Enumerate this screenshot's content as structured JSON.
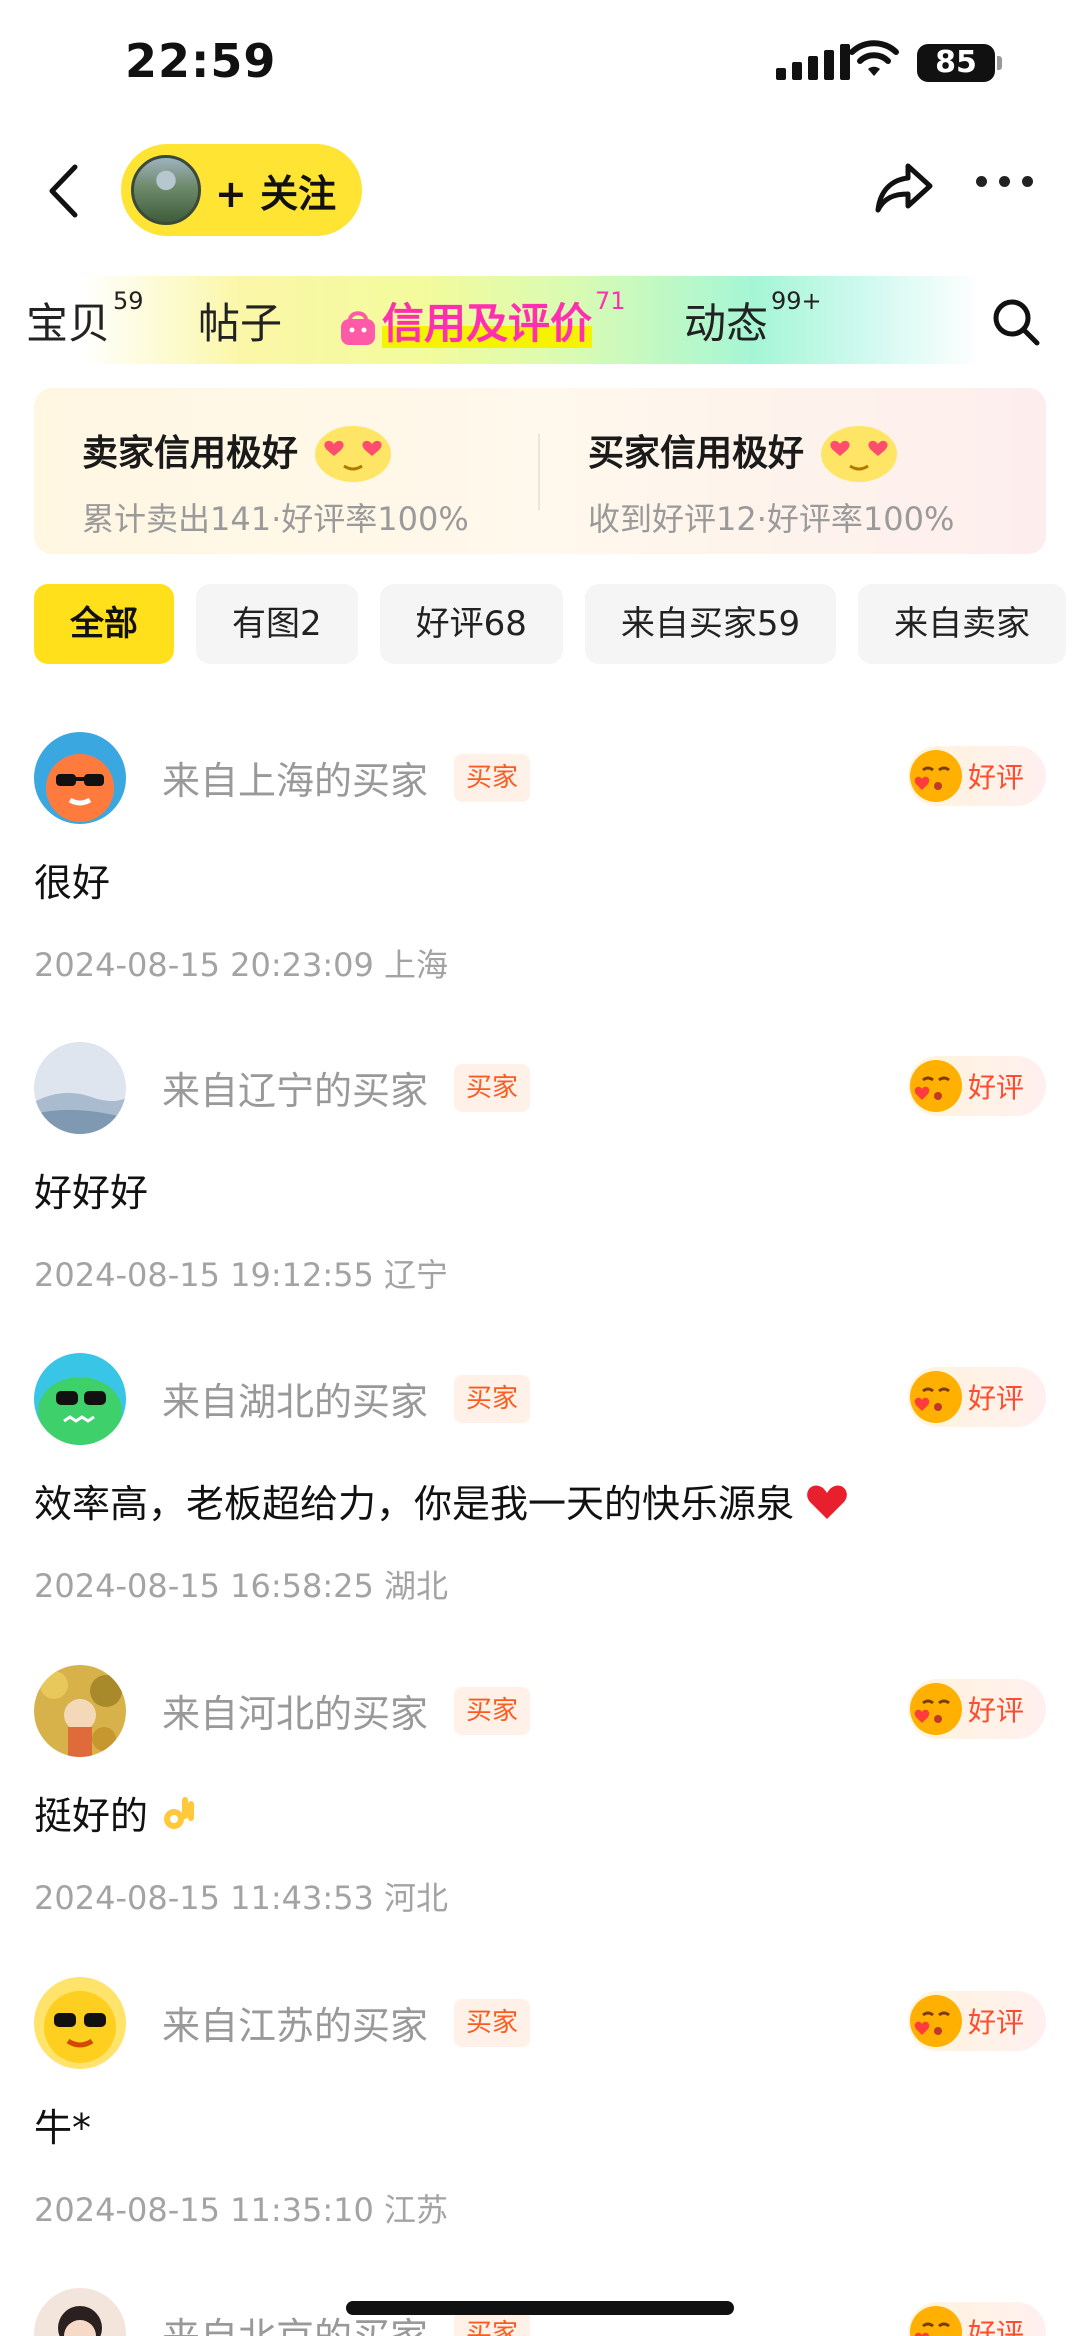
{
  "status_bar": {
    "time": "22:59",
    "battery": "85"
  },
  "header": {
    "follow_label": "+ 关注"
  },
  "tabs": [
    {
      "label": "宝贝",
      "count": "59"
    },
    {
      "label": "帖子",
      "count": ""
    },
    {
      "label": "信用及评价",
      "count": "71",
      "active": true
    },
    {
      "label": "动态",
      "count": "99+"
    }
  ],
  "credit": {
    "seller": {
      "title": "卖家信用极好",
      "sub": "累计卖出141·好评率100%"
    },
    "buyer": {
      "title": "买家信用极好",
      "sub": "收到好评12·好评率100%"
    }
  },
  "filters": [
    "全部",
    "有图2",
    "好评68",
    "来自买家59",
    "来自卖家"
  ],
  "reviews": [
    {
      "name": "来自上海的买家",
      "badge": "买家",
      "rating": "好评",
      "content": "很好",
      "time": "2024-08-15 20:23:09 上海"
    },
    {
      "name": "来自辽宁的买家",
      "badge": "买家",
      "rating": "好评",
      "content": "好好好",
      "time": "2024-08-15 19:12:55 辽宁"
    },
    {
      "name": "来自湖北的买家",
      "badge": "买家",
      "rating": "好评",
      "content": "效率高，老板超给力，你是我一天的快乐源泉",
      "time": "2024-08-15 16:58:25 湖北"
    },
    {
      "name": "来自河北的买家",
      "badge": "买家",
      "rating": "好评",
      "content": "挺好的",
      "time": "2024-08-15 11:43:53 河北"
    },
    {
      "name": "来自江苏的买家",
      "badge": "买家",
      "rating": "好评",
      "content": "牛*",
      "time": "2024-08-15 11:35:10 江苏"
    },
    {
      "name": "来自北京的买家",
      "badge": "买家",
      "rating": "好评",
      "content": "",
      "time": ""
    }
  ],
  "colors": {
    "accent_yellow": "#ffe433",
    "tab_active": "#ff2fb0",
    "badge_orange": "#ff5a1f"
  },
  "icons": [
    "back-arrow-icon",
    "share-icon",
    "more-icon",
    "search-icon",
    "bag-icon",
    "heart-eyes-icon",
    "kiss-face-icon",
    "heart-icon",
    "ok-hand-icon"
  ]
}
